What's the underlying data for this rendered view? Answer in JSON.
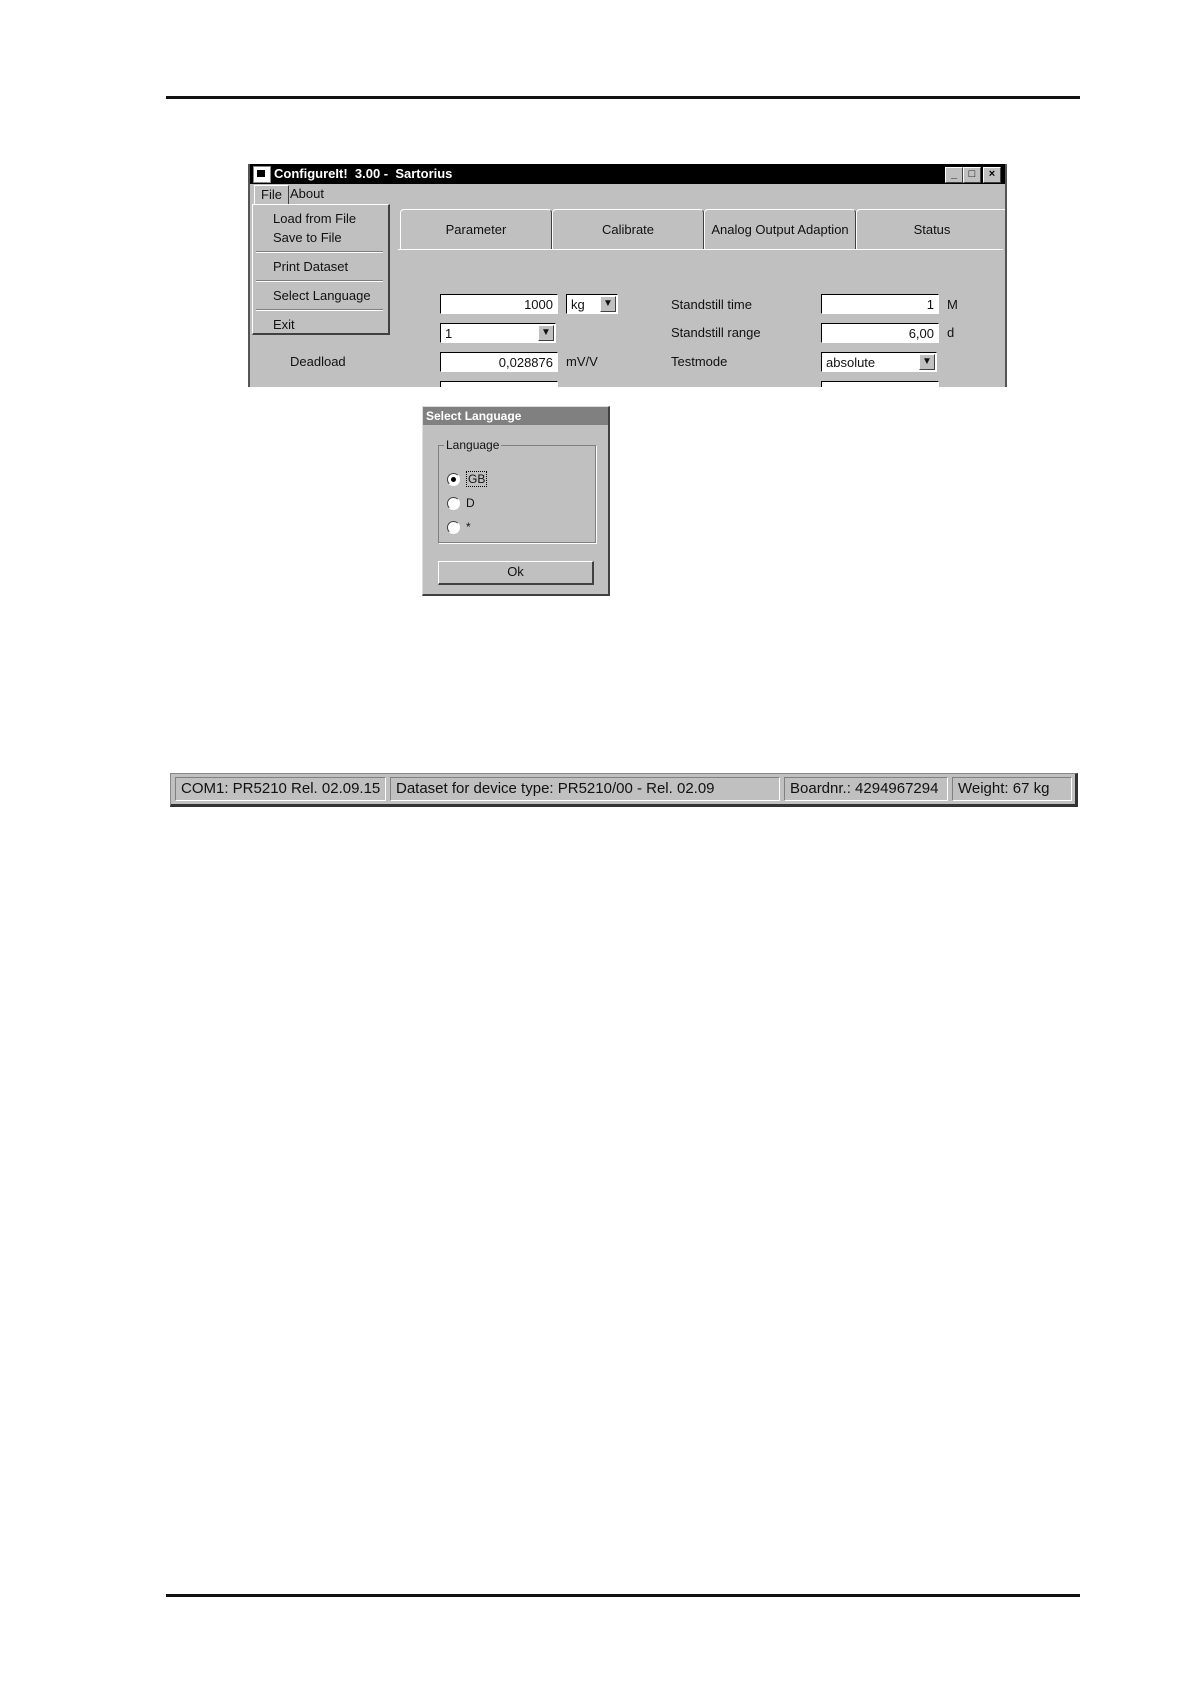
{
  "window": {
    "title": "ConfigureIt!  3.00 -  Sartorius",
    "controls": {
      "minimize": "_",
      "maximize": "□",
      "close": "×"
    }
  },
  "menubar": {
    "file": "File",
    "about": "About"
  },
  "file_menu": {
    "items": [
      "Load from File",
      "Save to File",
      "Print Dataset",
      "Select Language",
      "Exit"
    ]
  },
  "tabs": [
    "Parameter",
    "Calibrate",
    "Analog Output Adaption",
    "Status"
  ],
  "form": {
    "capacity_value": "1000",
    "unit_value": "kg",
    "second_dropdown_value": "1",
    "deadload_label": "Deadload",
    "deadload_value": "0,028876",
    "deadload_unit": "mV/V",
    "standstill_time_label": "Standstill time",
    "standstill_time_value": "1",
    "standstill_time_unit": "M",
    "standstill_range_label": "Standstill range",
    "standstill_range_value": "6,00",
    "standstill_range_unit": "d",
    "testmode_label": "Testmode",
    "testmode_value": "absolute"
  },
  "dialog": {
    "title": "Select Language",
    "group_label": "Language",
    "options": [
      "GB",
      "D",
      "*"
    ],
    "selected": "GB",
    "ok_label": "Ok"
  },
  "statusbar": {
    "port": "COM1:  PR5210 Rel. 02.09.15",
    "dataset": "Dataset for device type:  PR5210/00  -  Rel. 02.09",
    "board": "Boardnr.:  4294967294",
    "weight": "Weight:  67 kg"
  }
}
